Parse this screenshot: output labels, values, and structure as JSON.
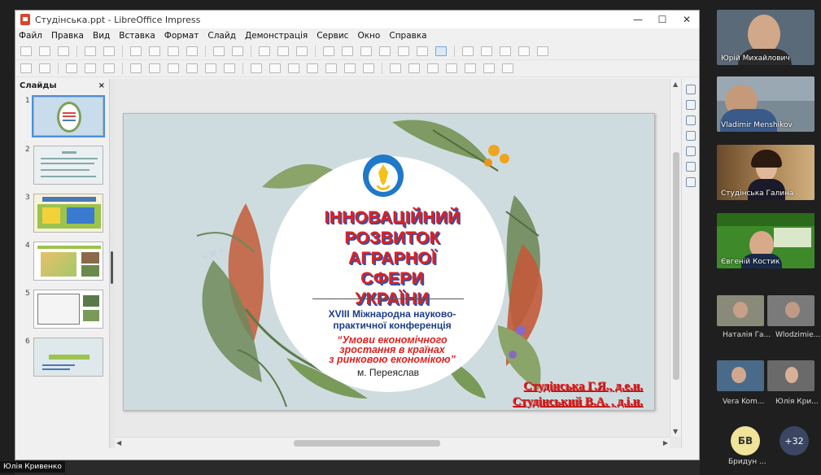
{
  "window": {
    "title": "Студінська.ppt - LibreOffice Impress",
    "minimize": "—",
    "maximize": "☐",
    "close": "✕"
  },
  "menu": [
    "Файл",
    "Правка",
    "Вид",
    "Вставка",
    "Формат",
    "Слайд",
    "Демонстрація",
    "Сервис",
    "Окно",
    "Справка"
  ],
  "slides_panel": {
    "title": "Слайды",
    "close": "×",
    "items": [
      {
        "num": "1"
      },
      {
        "num": "2"
      },
      {
        "num": "3"
      },
      {
        "num": "4"
      },
      {
        "num": "5"
      },
      {
        "num": "6"
      }
    ],
    "selected": 1
  },
  "slide": {
    "title_lines": [
      "ІННОВАЦІЙНИЙ",
      "РОЗВИТОК",
      "АГРАРНОЇ",
      "СФЕРИ",
      "УКРАЇНИ"
    ],
    "conference_lines": [
      "XVIII Міжнародна науково-",
      "практичної конференція"
    ],
    "theme_lines": [
      "“Умови економічного",
      "зростання в країнах",
      "з ринковою економікою”"
    ],
    "city": "м. Переяслав",
    "authors": [
      "Студінська Г.Я., д.е.н.",
      "Студінський В.А. , д.і.н."
    ]
  },
  "participants": {
    "tiles": [
      {
        "name": "Юрій Михайлович"
      },
      {
        "name": "Vladimir Menshikov"
      },
      {
        "name": "Студінська Галина"
      },
      {
        "name": "Євгеній Костик"
      }
    ],
    "small": [
      {
        "name": "Наталія Га..."
      },
      {
        "name": "Wlodzimie..."
      },
      {
        "name": "Vera Kom..."
      },
      {
        "name": "Юлія Кри..."
      }
    ],
    "avatar": {
      "initials": "БВ",
      "name": "Бридун ..."
    },
    "more": "+32"
  },
  "presenter": "Юлія Кривенко"
}
